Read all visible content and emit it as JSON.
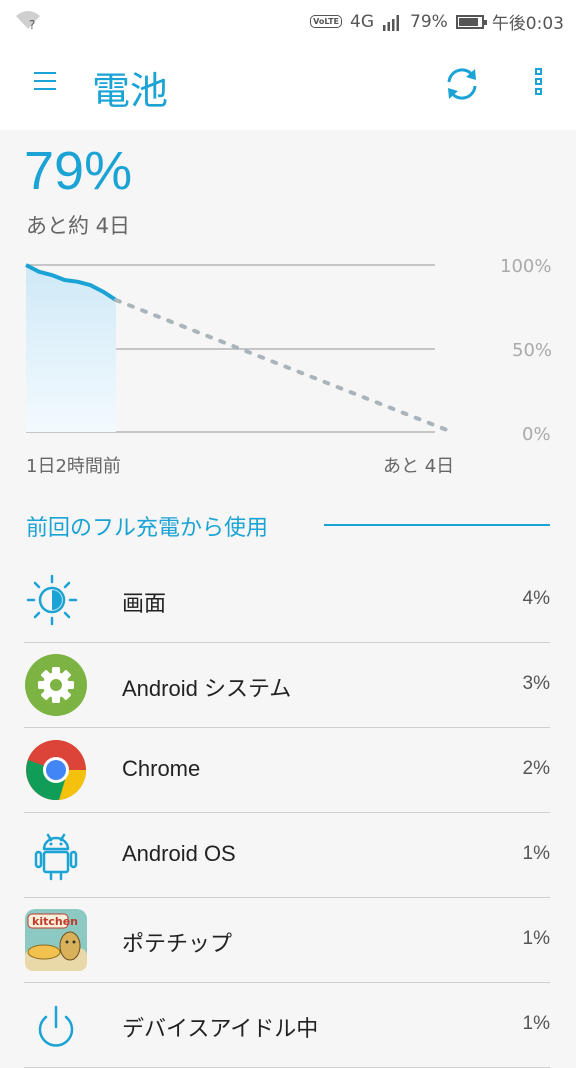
{
  "status_bar": {
    "network": "4G",
    "volte": "VoLTE",
    "battery": "79%",
    "battery_level": 0.79,
    "time": "午後0:03"
  },
  "app_bar": {
    "title": "電池",
    "menu_icon": "hamburger-menu-icon",
    "refresh_icon": "refresh-icon",
    "more_icon": "more-vertical-icon"
  },
  "battery": {
    "percent": "79%",
    "remaining": "あと約 4日"
  },
  "chart": {
    "x_start_label": "1日2時間前",
    "x_end_label": "あと 4日",
    "y_labels": [
      "100%",
      "50%",
      "0%"
    ],
    "accent_color": "#1aa3d4"
  },
  "chart_data": {
    "type": "line",
    "series": [
      {
        "values": [
          100,
          96,
          94,
          91,
          90,
          88,
          84,
          79
        ]
      },
      {
        "values": [
          79,
          0
        ]
      }
    ],
    "ylim": [
      0,
      100
    ]
  },
  "section_title": "前回のフル充電から使用",
  "apps": [
    {
      "name": "画面",
      "percent": "4%",
      "icon": "screen-brightness-icon"
    },
    {
      "name": "Android システム",
      "percent": "3%",
      "icon": "android-system-gear-icon"
    },
    {
      "name": "Chrome",
      "percent": "2%",
      "icon": "chrome-icon"
    },
    {
      "name": "Android OS",
      "percent": "1%",
      "icon": "android-robot-icon"
    },
    {
      "name": "ポテチップ",
      "percent": "1%",
      "icon": "potechip-app-icon",
      "icon_text": "kitchen"
    },
    {
      "name": "デバイスアイドル中",
      "percent": "1%",
      "icon": "power-icon"
    }
  ]
}
